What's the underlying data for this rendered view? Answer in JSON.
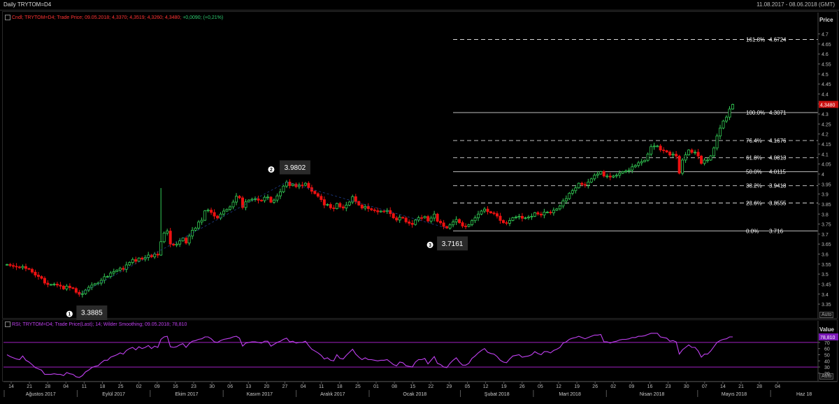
{
  "header": {
    "title": "Daily TRYTOM=D4",
    "range": "11.08.2017 - 08.06.2018 (GMT)"
  },
  "price_legend": {
    "name": "Cndl; TRYTOM=D4; Trade Price; 09.05.2018; 4,3370; 4,3519; 4,3260; 4,3480;",
    "change": "+0,0090; (+0,21%)",
    "axis_title": "Price",
    "auto": "Auto",
    "last_price": "4,3480"
  },
  "rsi_legend": {
    "name": "RSI; TRYTOM=D4; Trade Price(Last); 14; Wilder Smoothing; 09.05.2018; 78,810",
    "axis_title": "Value",
    "auto": "Auto",
    "last_value": "78,810"
  },
  "annotations": [
    {
      "num": "1",
      "label": "3.3885"
    },
    {
      "num": "2",
      "label": "3.9802"
    },
    {
      "num": "3",
      "label": "3.7161"
    }
  ],
  "chart_data": [
    {
      "type": "candlestick",
      "title": "Daily TRYTOM=D4",
      "ylabel": "Price",
      "ylim": [
        3.27,
        4.73
      ],
      "yticks": [
        3.35,
        3.4,
        3.45,
        3.5,
        3.55,
        3.6,
        3.65,
        3.7,
        3.75,
        3.8,
        3.85,
        3.9,
        3.95,
        4,
        4.05,
        4.1,
        4.15,
        4.2,
        4.25,
        4.3,
        4.35,
        4.4,
        4.45,
        4.5,
        4.55,
        4.6,
        4.65,
        4.7
      ],
      "ytick_labels": [
        "3.35",
        "3.4",
        "3.45",
        "3.5",
        "3.55",
        "3.6",
        "3.65",
        "3.7",
        "3.75",
        "3.8",
        "3.85",
        "3.9",
        "3.95",
        "4",
        "4.05",
        "4.1",
        "4.15",
        "4.2",
        "4.25",
        "4.3",
        "4.35",
        "4.4",
        "4.45",
        "4.5",
        "4.55",
        "4.6",
        "4.65",
        "4.7"
      ],
      "series": [
        {
          "name": "Trade Price",
          "close": [
            3.548,
            3.543,
            3.539,
            3.536,
            3.532,
            3.538,
            3.528,
            3.524,
            3.51,
            3.495,
            3.488,
            3.479,
            3.455,
            3.448,
            3.448,
            3.45,
            3.445,
            3.44,
            3.426,
            3.44,
            3.432,
            3.428,
            3.409,
            3.399,
            3.402,
            3.42,
            3.434,
            3.445,
            3.452,
            3.455,
            3.469,
            3.487,
            3.488,
            3.505,
            3.513,
            3.52,
            3.529,
            3.524,
            3.546,
            3.558,
            3.573,
            3.564,
            3.58,
            3.575,
            3.583,
            3.595,
            3.586,
            3.6,
            3.595,
            3.662,
            3.705,
            3.715,
            3.65,
            3.645,
            3.65,
            3.666,
            3.68,
            3.655,
            3.69,
            3.719,
            3.73,
            3.76,
            3.769,
            3.816,
            3.82,
            3.808,
            3.79,
            3.78,
            3.8,
            3.815,
            3.824,
            3.836,
            3.86,
            3.889,
            3.881,
            3.833,
            3.861,
            3.87,
            3.874,
            3.876,
            3.869,
            3.867,
            3.884,
            3.885,
            3.859,
            3.87,
            3.891,
            3.911,
            3.94,
            3.96,
            3.942,
            3.95,
            3.937,
            3.945,
            3.944,
            3.954,
            3.932,
            3.914,
            3.902,
            3.889,
            3.872,
            3.845,
            3.848,
            3.831,
            3.827,
            3.853,
            3.836,
            3.83,
            3.845,
            3.86,
            3.887,
            3.863,
            3.845,
            3.83,
            3.838,
            3.827,
            3.821,
            3.817,
            3.811,
            3.815,
            3.813,
            3.818,
            3.802,
            3.781,
            3.77,
            3.784,
            3.78,
            3.761,
            3.754,
            3.748,
            3.77,
            3.782,
            3.781,
            3.788,
            3.765,
            3.78,
            3.8,
            3.764,
            3.756,
            3.738,
            3.73,
            3.746,
            3.761,
            3.773,
            3.757,
            3.74,
            3.738,
            3.747,
            3.767,
            3.781,
            3.8,
            3.815,
            3.825,
            3.812,
            3.806,
            3.802,
            3.79,
            3.768,
            3.757,
            3.754,
            3.768,
            3.782,
            3.785,
            3.789,
            3.779,
            3.781,
            3.785,
            3.789,
            3.807,
            3.8,
            3.795,
            3.81,
            3.81,
            3.806,
            3.819,
            3.826,
            3.84,
            3.866,
            3.877,
            3.904,
            3.917,
            3.931,
            3.954,
            3.948,
            3.944,
            3.96,
            3.976,
            3.994,
            4.0,
            4.012,
            3.99,
            3.99,
            3.985,
            3.99,
            3.994,
            4.004,
            4.012,
            4.015,
            4.02,
            4.036,
            4.043,
            4.056,
            4.062,
            4.069,
            4.1,
            4.137,
            4.14,
            4.14,
            4.12,
            4.117,
            4.11,
            4.095,
            4.099,
            4.09,
            4.004,
            4.07,
            4.096,
            4.12,
            4.108,
            4.109,
            4.09,
            4.053,
            4.07,
            4.07,
            4.091,
            4.13,
            4.19,
            4.23,
            4.265,
            4.284,
            4.325,
            4.348
          ],
          "open": [
            3.548,
            3.548,
            3.543,
            3.539,
            3.536,
            3.532,
            3.538,
            3.528,
            3.524,
            3.51,
            3.495,
            3.488,
            3.479,
            3.455,
            3.448,
            3.448,
            3.45,
            3.445,
            3.44,
            3.426,
            3.44,
            3.432,
            3.428,
            3.409,
            3.399,
            3.402,
            3.42,
            3.434,
            3.445,
            3.452,
            3.455,
            3.469,
            3.487,
            3.488,
            3.505,
            3.513,
            3.52,
            3.529,
            3.524,
            3.546,
            3.558,
            3.573,
            3.564,
            3.58,
            3.575,
            3.583,
            3.595,
            3.586,
            3.6,
            3.595,
            3.662,
            3.705,
            3.715,
            3.65,
            3.645,
            3.65,
            3.666,
            3.68,
            3.655,
            3.69,
            3.719,
            3.73,
            3.76,
            3.769,
            3.816,
            3.82,
            3.808,
            3.79,
            3.78,
            3.8,
            3.815,
            3.824,
            3.836,
            3.86,
            3.889,
            3.881,
            3.833,
            3.861,
            3.87,
            3.874,
            3.876,
            3.869,
            3.867,
            3.884,
            3.885,
            3.859,
            3.87,
            3.891,
            3.911,
            3.94,
            3.96,
            3.942,
            3.95,
            3.937,
            3.945,
            3.944,
            3.954,
            3.932,
            3.914,
            3.902,
            3.889,
            3.872,
            3.845,
            3.848,
            3.831,
            3.827,
            3.853,
            3.836,
            3.83,
            3.845,
            3.86,
            3.887,
            3.863,
            3.845,
            3.83,
            3.838,
            3.827,
            3.821,
            3.817,
            3.811,
            3.815,
            3.813,
            3.818,
            3.802,
            3.781,
            3.77,
            3.784,
            3.78,
            3.761,
            3.754,
            3.748,
            3.77,
            3.782,
            3.781,
            3.788,
            3.765,
            3.78,
            3.8,
            3.764,
            3.756,
            3.738,
            3.73,
            3.746,
            3.761,
            3.773,
            3.757,
            3.74,
            3.738,
            3.747,
            3.767,
            3.781,
            3.8,
            3.815,
            3.825,
            3.812,
            3.806,
            3.802,
            3.79,
            3.768,
            3.757,
            3.754,
            3.768,
            3.782,
            3.785,
            3.789,
            3.779,
            3.781,
            3.785,
            3.789,
            3.807,
            3.8,
            3.795,
            3.81,
            3.81,
            3.806,
            3.819,
            3.826,
            3.84,
            3.866,
            3.877,
            3.904,
            3.917,
            3.931,
            3.954,
            3.948,
            3.944,
            3.96,
            3.976,
            3.994,
            4.0,
            4.012,
            3.99,
            3.99,
            3.985,
            3.99,
            3.994,
            4.004,
            4.012,
            4.015,
            4.02,
            4.036,
            4.043,
            4.056,
            4.062,
            4.069,
            4.1,
            4.137,
            4.14,
            4.14,
            4.12,
            4.117,
            4.11,
            4.095,
            4.099,
            4.09,
            4.004,
            4.07,
            4.096,
            4.12,
            4.108,
            4.109,
            4.09,
            4.053,
            4.07,
            4.07,
            4.091,
            4.13,
            4.19,
            4.23,
            4.265,
            4.284,
            4.325
          ]
        }
      ],
      "fibonacci": {
        "levels": [
          {
            "pct": "161.8%",
            "value": 4.6724,
            "label": "4.6724",
            "style": "dashed"
          },
          {
            "pct": "100.0%",
            "value": 4.3071,
            "label": "4.3071",
            "style": "solid"
          },
          {
            "pct": "76.4%",
            "value": 4.1676,
            "label": "4.1676",
            "style": "dashed"
          },
          {
            "pct": "61.8%",
            "value": 4.0813,
            "label": "4.0813",
            "style": "dashed"
          },
          {
            "pct": "50.0%",
            "value": 4.0115,
            "label": "4.0115",
            "style": "solid"
          },
          {
            "pct": "38.2%",
            "value": 3.9418,
            "label": "3.9418",
            "style": "dashed"
          },
          {
            "pct": "23.6%",
            "value": 3.8555,
            "label": "3.8555",
            "style": "dashed"
          },
          {
            "pct": "0.0%",
            "value": 3.716,
            "label": "3.716",
            "style": "solid"
          }
        ]
      },
      "colors": {
        "up": "#33cc55",
        "down": "#ee1111",
        "fib": "#d8d8d8",
        "last_marker": "#cc1111"
      }
    },
    {
      "type": "line",
      "title": "RSI",
      "ylabel": "Value",
      "ylim": [
        13,
        87
      ],
      "yticks": [
        20,
        30,
        40,
        50,
        60,
        70
      ],
      "ytick_labels": [
        "20",
        "30",
        "40",
        "50",
        "60",
        "70"
      ],
      "reference_lines": [
        70,
        30
      ],
      "series": [
        {
          "name": "RSI",
          "values": [
            50,
            47,
            45,
            43,
            42,
            48,
            41,
            38,
            34,
            29,
            27,
            25,
            18,
            18,
            18,
            19,
            18,
            18,
            16,
            21,
            19,
            18,
            14,
            13,
            16,
            22,
            25,
            29,
            31,
            32,
            37,
            41,
            41,
            46,
            48,
            50,
            53,
            51,
            57,
            60,
            62,
            58,
            63,
            60,
            62,
            65,
            60,
            64,
            62,
            75,
            79,
            80,
            63,
            62,
            63,
            66,
            68,
            62,
            68,
            72,
            73,
            75,
            76,
            79,
            79,
            76,
            71,
            70,
            73,
            75,
            76,
            77,
            79,
            80,
            77,
            64,
            69,
            70,
            71,
            71,
            70,
            69,
            72,
            72,
            64,
            67,
            70,
            72,
            75,
            77,
            71,
            72,
            69,
            70,
            70,
            72,
            65,
            59,
            56,
            53,
            49,
            43,
            45,
            41,
            40,
            50,
            44,
            43,
            49,
            54,
            59,
            51,
            46,
            42,
            45,
            42,
            42,
            41,
            40,
            41,
            41,
            42,
            38,
            34,
            32,
            38,
            37,
            32,
            31,
            30,
            38,
            42,
            42,
            44,
            35,
            41,
            47,
            36,
            34,
            30,
            29,
            36,
            41,
            45,
            38,
            33,
            33,
            36,
            44,
            48,
            53,
            57,
            60,
            54,
            52,
            51,
            47,
            41,
            38,
            37,
            43,
            48,
            49,
            50,
            46,
            47,
            48,
            50,
            55,
            52,
            50,
            55,
            55,
            53,
            57,
            59,
            62,
            69,
            71,
            75,
            77,
            78,
            80,
            78,
            76,
            78,
            80,
            82,
            82,
            83,
            71,
            71,
            69,
            71,
            72,
            74,
            75,
            75,
            76,
            78,
            78,
            80,
            80,
            81,
            83,
            85,
            85,
            85,
            79,
            78,
            77,
            72,
            73,
            71,
            51,
            58,
            62,
            66,
            62,
            62,
            56,
            46,
            51,
            51,
            56,
            63,
            70,
            73,
            75,
            76,
            79,
            79
          ]
        }
      ]
    }
  ],
  "x_axis": {
    "day_labels": [
      "14",
      "21",
      "28",
      "04",
      "11",
      "18",
      "25",
      "02",
      "09",
      "16",
      "23",
      "30",
      "06",
      "13",
      "20",
      "27",
      "04",
      "11",
      "18",
      "25",
      "01",
      "08",
      "15",
      "22",
      "29",
      "05",
      "12",
      "19",
      "26",
      "05",
      "12",
      "19",
      "26",
      "02",
      "09",
      "16",
      "23",
      "30",
      "07",
      "14",
      "21",
      "28",
      "04"
    ],
    "month_labels": [
      "Ağustos 2017",
      "Eylül 2017",
      "Ekim 2017",
      "Kasım 2017",
      "Aralık 2017",
      "Ocak 2018",
      "Şubat 2018",
      "Mart 2018",
      "Nisan 2018",
      "Mayıs 2018",
      "Haz 18"
    ]
  }
}
